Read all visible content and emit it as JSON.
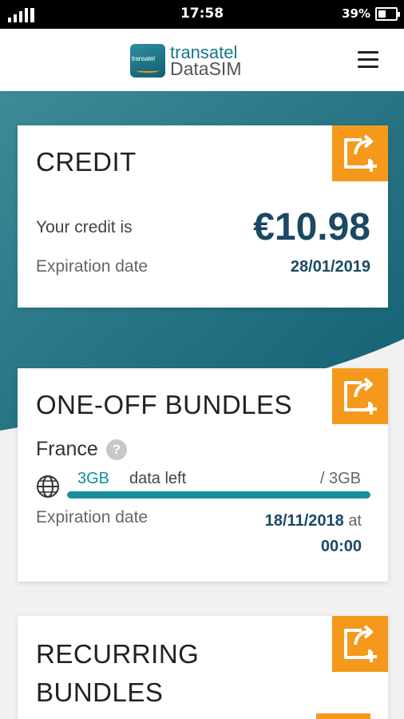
{
  "status_bar": {
    "time": "17:58",
    "battery": "39%"
  },
  "header": {
    "logo_line1": "transatel",
    "logo_line2": "DataSIM",
    "logo_mark_text": "transatel"
  },
  "credit": {
    "title": "CREDIT",
    "credit_label": "Your credit is",
    "amount": "€10.98",
    "expiration_label": "Expiration date",
    "expiration_date": "28/01/2019"
  },
  "oneoff": {
    "title": "ONE-OFF BUNDLES",
    "country": "France",
    "help": "?",
    "data_amount": "3GB",
    "data_left_label": "data left",
    "data_total": "/ 3GB",
    "progress_fraction": 1.0,
    "expiration_label": "Expiration date",
    "expiration_date": "18/11/2018",
    "expiration_at": "at",
    "expiration_time": "00:00"
  },
  "recurring": {
    "title_line1": "RECURRING",
    "title_line2": "BUNDLES"
  },
  "colors": {
    "accent_orange": "#f4991c",
    "teal": "#1a6b80",
    "value_blue": "#1a4a63"
  },
  "icons": {
    "menu": "hamburger-icon",
    "add": "external-add-icon",
    "globe": "globe-icon"
  }
}
